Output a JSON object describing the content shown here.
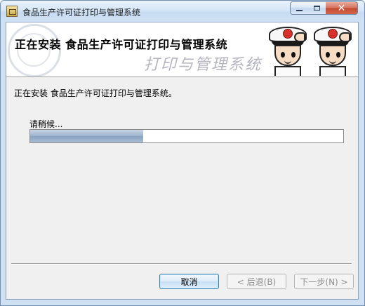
{
  "window": {
    "title": "食品生产许可证打印与管理系统",
    "controls": {
      "minimize": "",
      "maximize": "",
      "close": "✕"
    }
  },
  "banner": {
    "heading": "正在安装 食品生产许可证打印与管理系统",
    "slogan": "打印与管理系统"
  },
  "content": {
    "status": "正在安装 食品生产许可证打印与管理系统。",
    "wait_label": "请稍候...",
    "progress_fraction": 0.36
  },
  "buttons": {
    "cancel": "取消",
    "back": "< 后退(B)",
    "next": "下一步(N) >"
  },
  "colors": {
    "progress_fill": "#9cb2cb",
    "close_button": "#c24a31"
  }
}
